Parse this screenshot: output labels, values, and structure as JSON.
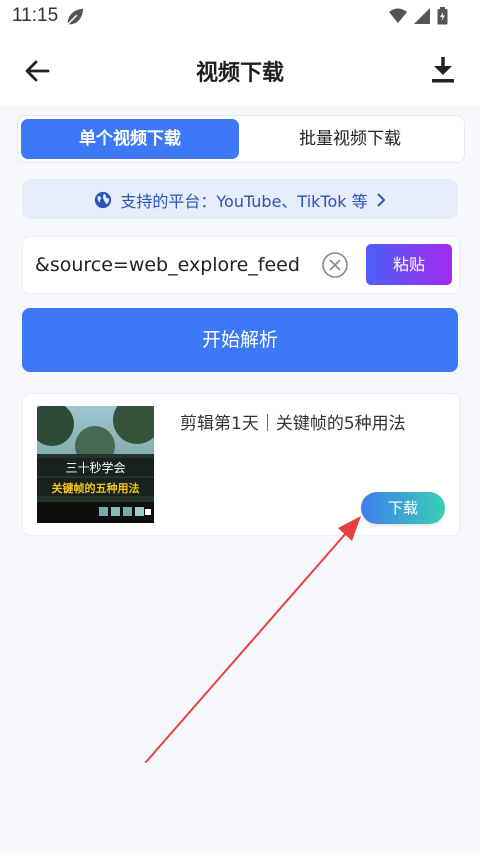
{
  "status_bar": {
    "time": "11:15"
  },
  "app_bar": {
    "title": "视频下载"
  },
  "tabs": [
    {
      "label": "单个视频下载",
      "active": true
    },
    {
      "label": "批量视频下载",
      "active": false
    }
  ],
  "platform": {
    "text": "支持的平台：YouTube、TikTok 等"
  },
  "url_field": {
    "value": "&source=web_explore_feed"
  },
  "paste_button": "粘贴",
  "parse_button": "开始解析",
  "result": {
    "title": "剪辑第1天｜关键帧的5种用法",
    "thumbnail_line1": "三十秒学会",
    "thumbnail_line2": "关键帧的五种用法",
    "download_label": "下载"
  },
  "colors": {
    "primary": "#3d78f7",
    "paste_gradient": [
      "#4b5ff5",
      "#a52bf0"
    ],
    "download_gradient": [
      "#3f7cf1",
      "#38d0b4"
    ],
    "annotation_arrow": "#e8403f"
  }
}
